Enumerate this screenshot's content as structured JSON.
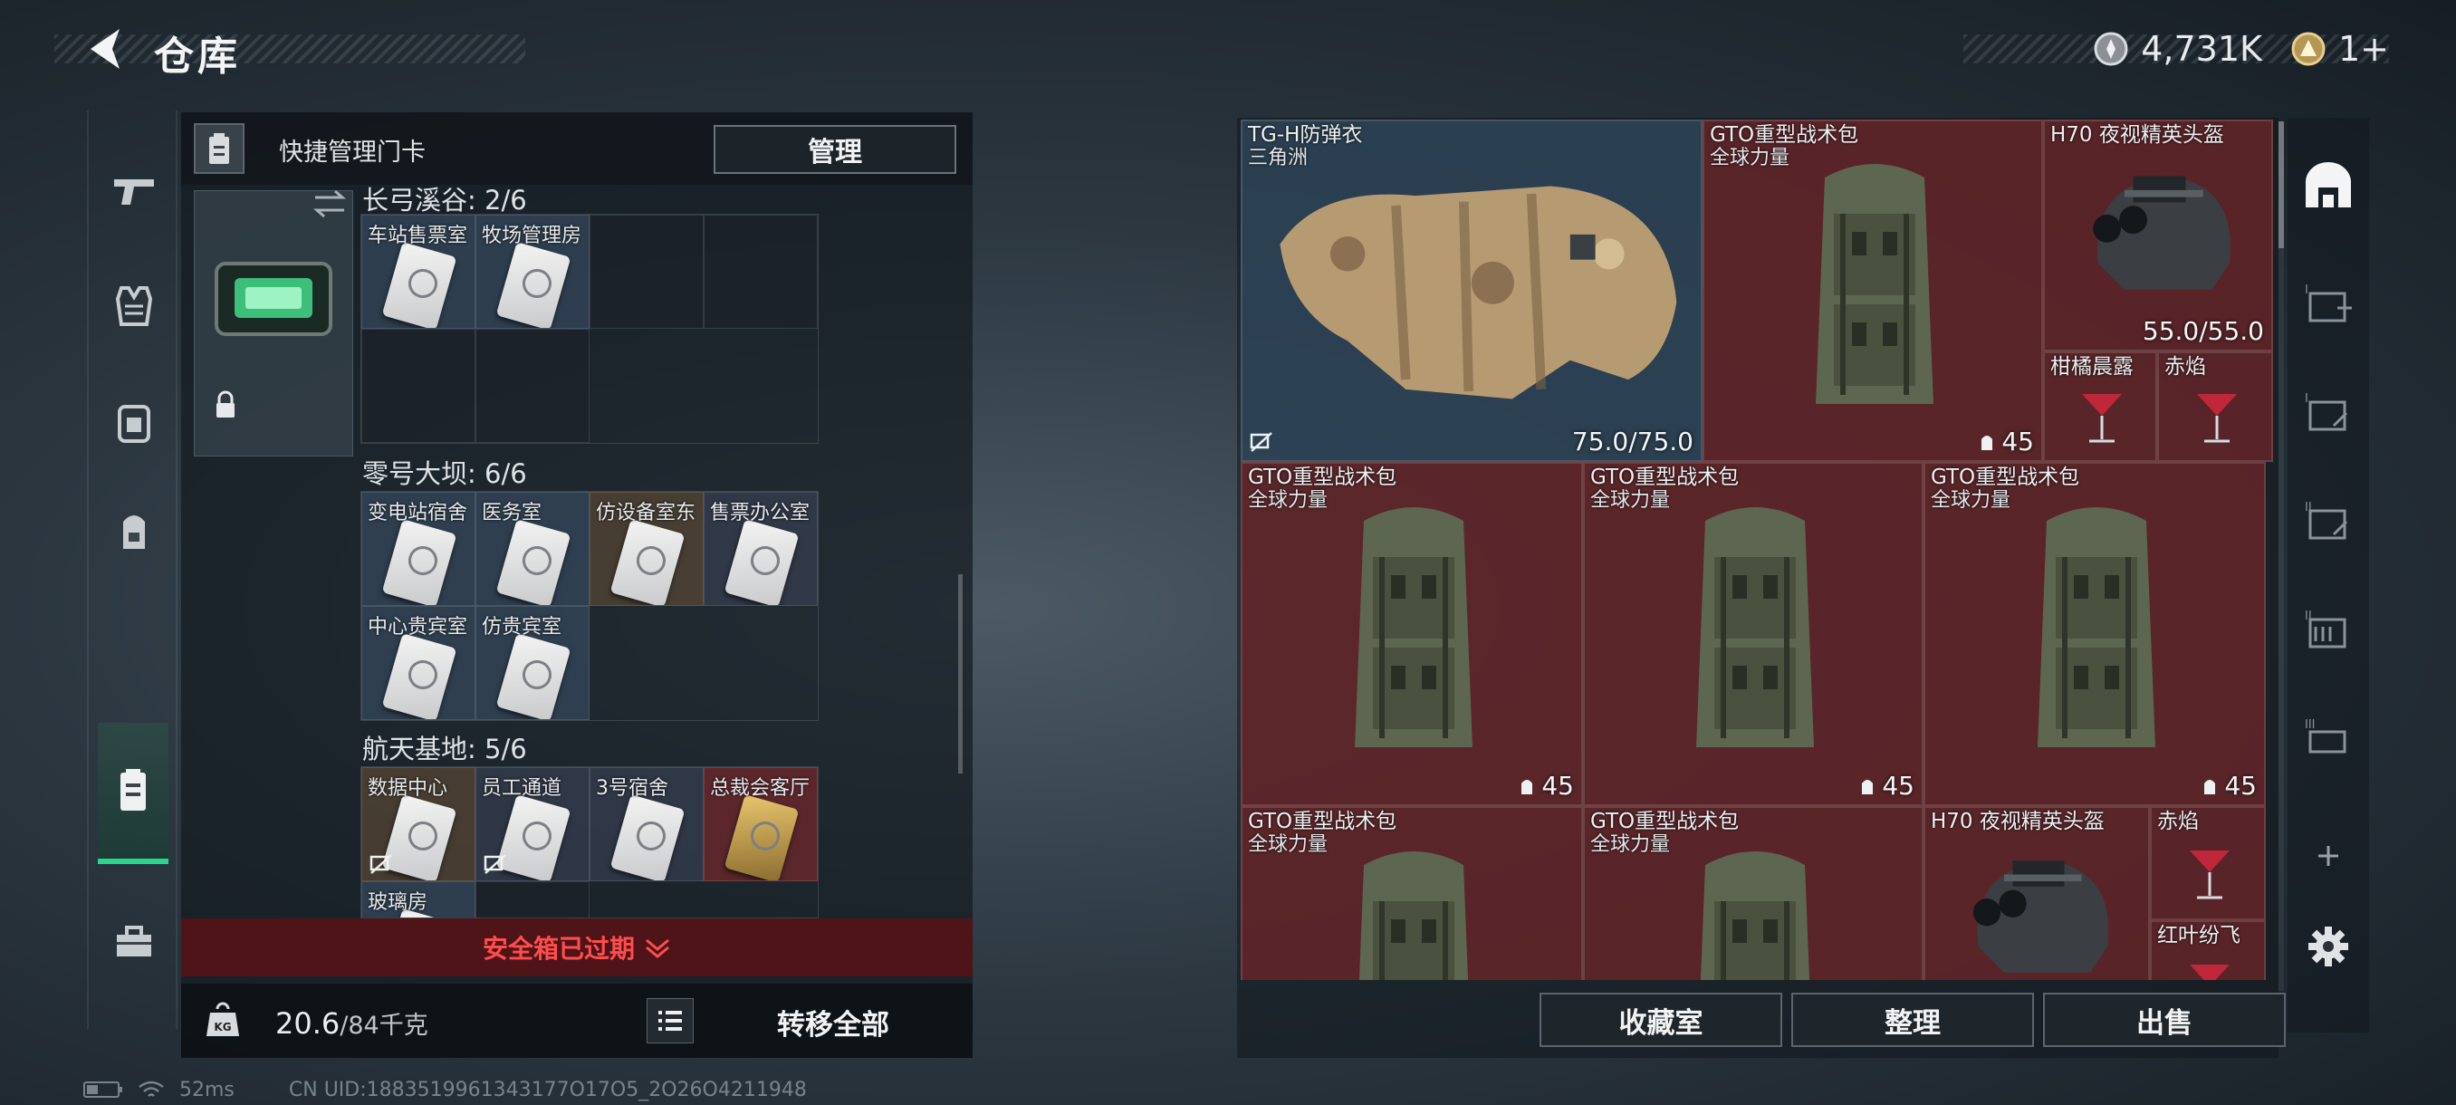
{
  "topbar": {
    "title": "仓库",
    "currency_amount": "4,731K",
    "tickets_amount": "1+",
    "currency_icon": "coin-icon",
    "tickets_icon": "token-icon"
  },
  "left_panel": {
    "header_title": "快捷管理门卡",
    "manage_label": "管理",
    "regions": [
      {
        "title": "长弓溪谷: 2/6",
        "cells": [
          {
            "label": "车站售票室",
            "color": "blue",
            "card": true
          },
          {
            "label": "牧场管理房",
            "color": "blue",
            "card": true
          },
          {
            "label": "",
            "color": "empty",
            "card": false
          },
          {
            "label": "",
            "color": "empty",
            "card": false
          },
          {
            "label": "",
            "color": "empty",
            "card": false
          },
          {
            "label": "",
            "color": "empty",
            "card": false
          }
        ]
      },
      {
        "title": "零号大坝: 6/6",
        "cells": [
          {
            "label": "变电站宿舍",
            "color": "blue",
            "card": true
          },
          {
            "label": "医务室",
            "color": "blue",
            "card": true
          },
          {
            "label": "仿设备室东",
            "color": "brown",
            "card": true
          },
          {
            "label": "售票办公室",
            "color": "slate",
            "card": true
          },
          {
            "label": "中心贵宾室",
            "color": "blue",
            "card": true
          },
          {
            "label": "仿贵宾室",
            "color": "blue",
            "card": true
          }
        ]
      },
      {
        "title": "航天基地: 5/6",
        "cells": [
          {
            "label": "数据中心",
            "color": "brown",
            "card": true,
            "nolink": true
          },
          {
            "label": "员工通道",
            "color": "slate",
            "card": true,
            "nolink": true
          },
          {
            "label": "3号宿舍",
            "color": "slate",
            "card": true
          },
          {
            "label": "总裁会客厅",
            "color": "red",
            "card": true,
            "gold": true
          },
          {
            "label": "玻璃房",
            "color": "blue",
            "card": true
          },
          {
            "label": "",
            "color": "empty",
            "card": false
          }
        ]
      }
    ],
    "expired_label": "安全箱已过期",
    "weight_value": "20.6",
    "weight_max": "/84千克",
    "transfer_label": "转移全部"
  },
  "stash": {
    "items": [
      {
        "name": "TG-H防弹衣",
        "sub": "三角洲",
        "stat": "75.0/75.0",
        "kind": "vest",
        "color": "blue"
      },
      {
        "name": "GTO重型战术包",
        "sub": "全球力量",
        "count": "45",
        "kind": "backpack",
        "color": "red"
      },
      {
        "name": "H70 夜视精英头盔",
        "sub": "",
        "stat": "55.0/55.0",
        "kind": "helmet",
        "color": "red"
      },
      {
        "name": "柑橘晨露",
        "sub": "",
        "kind": "cocktail",
        "color": "red"
      },
      {
        "name": "赤焰",
        "sub": "",
        "kind": "cocktail",
        "color": "red"
      },
      {
        "name": "GTO重型战术包",
        "sub": "全球力量",
        "count": "45",
        "kind": "backpack",
        "color": "red"
      },
      {
        "name": "GTO重型战术包",
        "sub": "全球力量",
        "count": "45",
        "kind": "backpack",
        "color": "red"
      },
      {
        "name": "GTO重型战术包",
        "sub": "全球力量",
        "count": "45",
        "kind": "backpack",
        "color": "red"
      },
      {
        "name": "GTO重型战术包",
        "sub": "全球力量",
        "count": "",
        "kind": "backpack",
        "color": "red"
      },
      {
        "name": "GTO重型战术包",
        "sub": "全球力量",
        "count": "",
        "kind": "backpack",
        "color": "red"
      },
      {
        "name": "H70 夜视精英头盔",
        "sub": "",
        "kind": "helmet",
        "color": "red"
      },
      {
        "name": "赤焰",
        "sub": "",
        "kind": "cocktail",
        "color": "red"
      },
      {
        "name": "红叶纷飞",
        "sub": "",
        "kind": "cocktail",
        "color": "red"
      }
    ],
    "buttons": {
      "collection": "收藏室",
      "sort": "整理",
      "sell": "出售"
    }
  },
  "statusbar": {
    "ping": "52ms",
    "uid": "CN UID:1883519961343177O17O5_2O26O4211948"
  },
  "colors": {
    "accent_green": "#2bd58a",
    "expired_red": "#ff4d4d",
    "item_red": "#68262a",
    "item_blue": "#30485c"
  }
}
